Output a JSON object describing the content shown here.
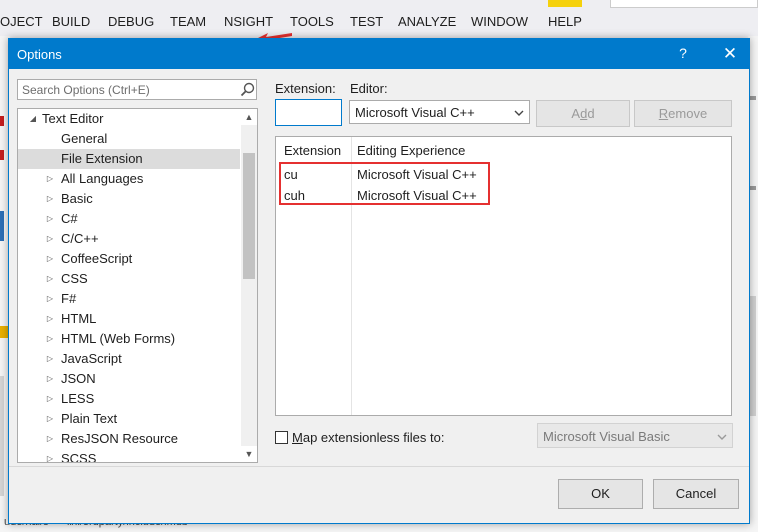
{
  "ide": {
    "menu": [
      "OJECT",
      "BUILD",
      "DEBUG",
      "TEAM",
      "NSIGHT",
      "TOOLS",
      "TEST",
      "ANALYZE",
      "WINDOW",
      "HELP"
    ],
    "bottom_path_text": "ude/nai/s·····ii/li/3rdparty/include/imdb"
  },
  "dialog": {
    "title": "Options",
    "help_glyph": "?",
    "close_glyph": "✕",
    "search": {
      "placeholder": "Search Options (Ctrl+E)",
      "value": ""
    },
    "tree": [
      {
        "label": "Text Editor",
        "level": 0,
        "expanded": true,
        "selected": false
      },
      {
        "label": "General",
        "level": 1,
        "selected": false
      },
      {
        "label": "File Extension",
        "level": 1,
        "selected": true
      },
      {
        "label": "All Languages",
        "level": 1,
        "collapsed": true
      },
      {
        "label": "Basic",
        "level": 1,
        "collapsed": true
      },
      {
        "label": "C#",
        "level": 1,
        "collapsed": true
      },
      {
        "label": "C/C++",
        "level": 1,
        "collapsed": true
      },
      {
        "label": "CoffeeScript",
        "level": 1,
        "collapsed": true
      },
      {
        "label": "CSS",
        "level": 1,
        "collapsed": true
      },
      {
        "label": "F#",
        "level": 1,
        "collapsed": true
      },
      {
        "label": "HTML",
        "level": 1,
        "collapsed": true
      },
      {
        "label": "HTML (Web Forms)",
        "level": 1,
        "collapsed": true
      },
      {
        "label": "JavaScript",
        "level": 1,
        "collapsed": true
      },
      {
        "label": "JSON",
        "level": 1,
        "collapsed": true
      },
      {
        "label": "LESS",
        "level": 1,
        "collapsed": true
      },
      {
        "label": "Plain Text",
        "level": 1,
        "collapsed": true
      },
      {
        "label": "ResJSON Resource",
        "level": 1,
        "collapsed": true
      },
      {
        "label": "SCSS",
        "level": 1,
        "collapsed": true
      }
    ],
    "extension_label": "Extension:",
    "extension_value": "",
    "editor_label": "Editor:",
    "editor_value": "Microsoft Visual C++",
    "add_button": {
      "prefix": "A",
      "underlined": "d",
      "suffix": "d"
    },
    "remove_button": {
      "prefix": "",
      "underlined": "R",
      "suffix": "emove"
    },
    "table": {
      "headers": [
        "Extension",
        "Editing Experience"
      ],
      "rows": [
        {
          "extension": "cu",
          "experience": "Microsoft Visual C++"
        },
        {
          "extension": "cuh",
          "experience": "Microsoft Visual C++"
        }
      ]
    },
    "map_extensionless": {
      "underlined": "M",
      "label_rest": "ap extensionless files to:",
      "checked": false,
      "value": "Microsoft Visual Basic"
    },
    "ok_label": "OK",
    "cancel_label": "Cancel"
  },
  "colors": {
    "accent": "#007acc",
    "highlight_box": "#e53030",
    "selected_row": "#dcdcdc"
  }
}
